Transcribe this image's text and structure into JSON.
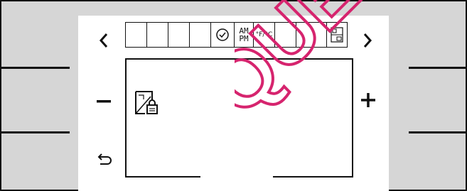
{
  "nav": {
    "prev_label": "<",
    "next_label": ">"
  },
  "controls": {
    "minus_label": "−",
    "plus_label": "+"
  },
  "status_bar": {
    "cells": [
      {
        "name": "empty-segment-1",
        "label": ""
      },
      {
        "name": "empty-segment-2",
        "label": ""
      },
      {
        "name": "empty-segment-3",
        "label": ""
      },
      {
        "name": "empty-segment-4",
        "label": ""
      },
      {
        "name": "clock",
        "icon": "clock-icon"
      },
      {
        "name": "ampm",
        "top": "AM",
        "bottom": "PM"
      },
      {
        "name": "unit",
        "label": "°F/°C"
      },
      {
        "name": "empty-segment-5",
        "label": ""
      },
      {
        "name": "empty-segment-6",
        "label": ""
      },
      {
        "name": "lock-status",
        "icon": "lock-screen-icon"
      }
    ]
  },
  "display": {
    "icon": "screen-lock-icon"
  },
  "watermark": {
    "text": "QUE",
    "color": "#d6246e"
  },
  "back": {
    "icon": "back-arrow-icon"
  }
}
